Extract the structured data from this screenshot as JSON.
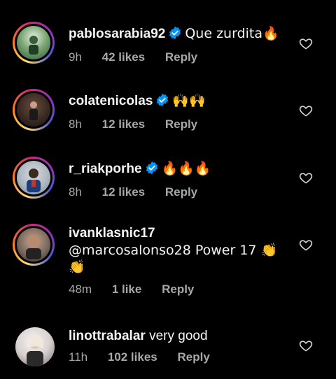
{
  "comments": [
    {
      "username": "pablosarabia92",
      "verified": true,
      "text": "Que zurdita🔥",
      "time": "9h",
      "likes": "42 likes",
      "reply": "Reply",
      "avatar_ring": true
    },
    {
      "username": "colatenicolas",
      "verified": true,
      "text": "🙌🙌",
      "time": "8h",
      "likes": "12 likes",
      "reply": "Reply",
      "avatar_ring": true
    },
    {
      "username": "r_riakporhe",
      "verified": true,
      "text": "🔥🔥🔥",
      "time": "8h",
      "likes": "12 likes",
      "reply": "Reply",
      "avatar_ring": true
    },
    {
      "username": "ivanklasnic17",
      "verified": false,
      "text_line1": "@marcosalonso28 Power 17 👏",
      "text_line2": "👏",
      "time": "48m",
      "likes": "1 like",
      "reply": "Reply",
      "avatar_ring": true
    },
    {
      "username": "linottrabalar",
      "verified": false,
      "text": "very good",
      "time": "11h",
      "likes": "102 likes",
      "reply": "Reply",
      "avatar_ring": false
    }
  ],
  "colors": {
    "background": "#000000",
    "text": "#f5f5f5",
    "meta": "#a8a8a8",
    "verified": "#0095f6"
  }
}
